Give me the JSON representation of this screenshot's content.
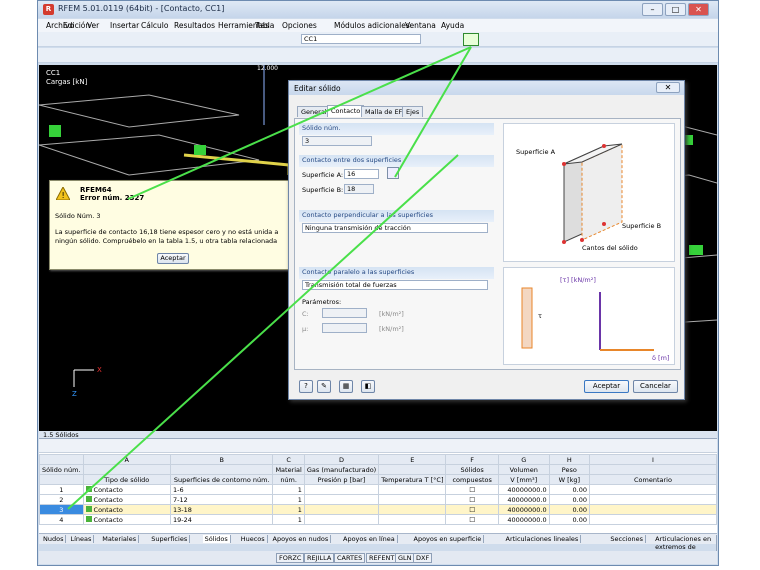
{
  "window": {
    "title": "RFEM 5.01.0119 (64bit) - [Contacto, CC1]"
  },
  "menu": [
    "Archivo",
    "Edición",
    "Ver",
    "Insertar",
    "Cálculo",
    "Resultados",
    "Herramientas",
    "Tabla",
    "Opciones",
    "Módulos adicionales",
    "Ventana",
    "Ayuda"
  ],
  "toolbar": {
    "loadcase": "CC1"
  },
  "canvas": {
    "lc": "CC1",
    "loads": "Cargas [kN]",
    "axis_x": "X",
    "axis_z": "Z",
    "dim_label": "12.000"
  },
  "error": {
    "app": "RFEM64",
    "code": "Error núm. 2327",
    "object": "Sólido Núm. 3",
    "message": "La superficie de contacto 16,18 tiene espesor cero y no está unida a ningún sólido. Compruébelo en la tabla 1.5, u otra tabla relacionada",
    "ok": "Aceptar"
  },
  "dialog": {
    "title": "Editar sólido",
    "tabs": [
      "General",
      "Contacto",
      "Malla de EF",
      "Ejes"
    ],
    "solid_no_label": "Sólido núm.",
    "solid_no": "3",
    "contact_two_label": "Contacto entre dos superficies",
    "surfA_label": "Superficie A:",
    "surfA": "16",
    "surfB_label": "Superficie B:",
    "surfB": "18",
    "perp_label": "Contacto perpendicular a las superficies",
    "perp_value": "Ninguna transmisión de tracción",
    "par_label": "Contacto paralelo a las superficies",
    "par_value": "Transmisión total de fuerzas",
    "params_label": "Parámetros:",
    "c_label": "C:",
    "c_unit": "[kN/m²]",
    "mu_label": "μ:",
    "mu_unit": "[kN/m²]",
    "fig_surfA": "Superficie A",
    "fig_surfB": "Superficie B",
    "fig_edges": "Cantos del sólido",
    "fig_tau": "[τ] [kN/m²]",
    "fig_delta": "δ [m]",
    "fig_t": "τ",
    "ok": "Aceptar",
    "cancel": "Cancelar"
  },
  "grid": {
    "title": "1.5 Sólidos",
    "letters": [
      "A",
      "B",
      "C",
      "D",
      "E",
      "F",
      "G",
      "H",
      "I"
    ],
    "head1": [
      "Sólido núm.",
      "",
      "",
      "Material",
      "Gas (manufacturado)",
      "",
      "Sólidos",
      "Volumen",
      "Peso",
      ""
    ],
    "head2": [
      "",
      "Tipo de sólido",
      "Superficies de contorno núm.",
      "núm.",
      "Presión p [bar]",
      "Temperatura T [°C]",
      "compuestos",
      "V [mm³]",
      "W [kg]",
      "Comentario"
    ],
    "rows": [
      [
        "1",
        "Contacto",
        "1-6",
        "1",
        "",
        "",
        "",
        "40000000.0",
        "0.00",
        ""
      ],
      [
        "2",
        "Contacto",
        "7-12",
        "1",
        "",
        "",
        "",
        "40000000.0",
        "0.00",
        ""
      ],
      [
        "3",
        "Contacto",
        "13-18",
        "1",
        "",
        "",
        "",
        "40000000.0",
        "0.00",
        ""
      ],
      [
        "4",
        "Contacto",
        "19-24",
        "1",
        "",
        "",
        "",
        "40000000.0",
        "0.00",
        ""
      ]
    ]
  },
  "sheets": [
    "Nudos",
    "Líneas",
    "Materiales",
    "Superficies",
    "Sólidos",
    "Huecos",
    "Apoyos en nudos",
    "Apoyos en línea",
    "Apoyos en superficie",
    "Articulaciones lineales",
    "Secciones",
    "Articulaciones en extremos de barras"
  ],
  "status": [
    "FORZC",
    "REJILLA",
    "CARTES",
    "REFENT",
    "GLN",
    "DXF"
  ]
}
